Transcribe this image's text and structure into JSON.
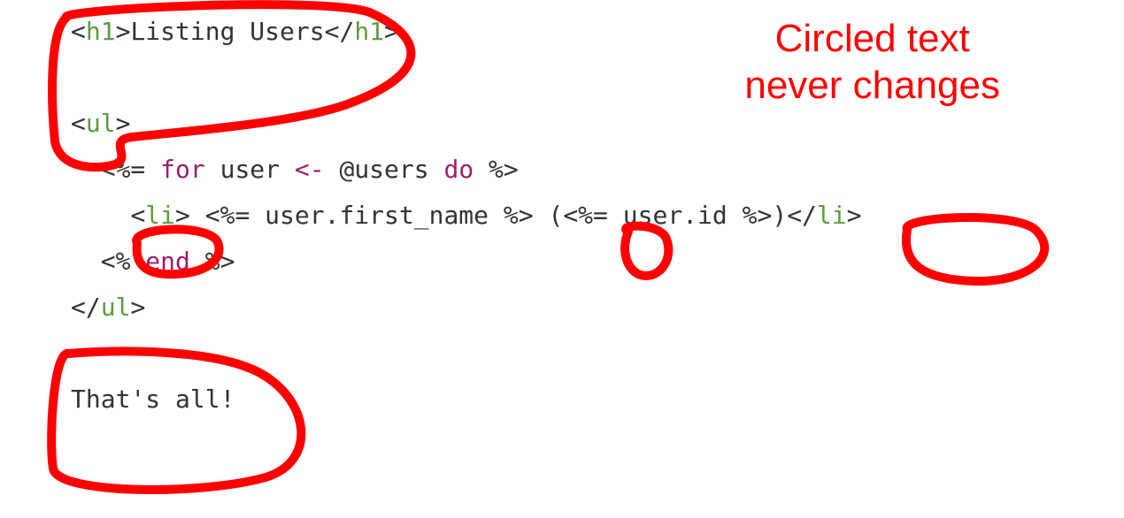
{
  "annotation": {
    "line1": "Circled text",
    "line2": "never changes"
  },
  "code": {
    "line1": {
      "open_lt": "<",
      "open_tag": "h1",
      "open_gt": ">",
      "text": "Listing Users",
      "close_lt": "</",
      "close_tag": "h1",
      "close_gt": ">"
    },
    "line2": "",
    "line3": {
      "open_lt": "<",
      "tag": "ul",
      "open_gt": ">"
    },
    "line4": {
      "indent": "  ",
      "erb_open": "<%= ",
      "kw_for": "for",
      "mid1": " user ",
      "arrow": "<-",
      "mid2": " @users ",
      "kw_do": "do",
      "erb_close": " %>"
    },
    "line5": {
      "indent": "    ",
      "li_open_lt": "<",
      "li_open_tag": "li",
      "li_open_gt": ">",
      "space1": " ",
      "erb1": "<%= user.first_name %>",
      "paren_open": " (",
      "erb2": "<%= user.id %>",
      "paren_close": ")",
      "li_close_lt": "</",
      "li_close_tag": "li",
      "li_close_gt": ">"
    },
    "line6": {
      "indent": "  ",
      "erb_open": "<% ",
      "kw_end": "end",
      "erb_close": " %>"
    },
    "line7": {
      "close_lt": "</",
      "tag": "ul",
      "close_gt": ">"
    },
    "line8": "",
    "line9": "That's all!"
  }
}
